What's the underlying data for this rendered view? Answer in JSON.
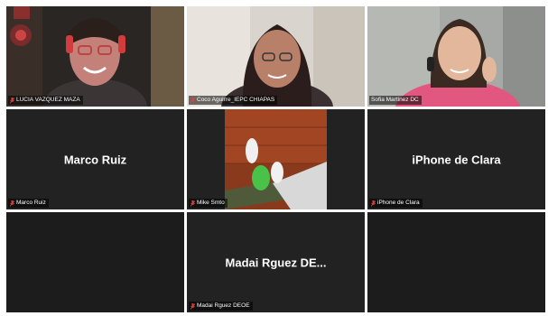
{
  "meeting": {
    "tiles": [
      {
        "label": "LUCIA VAZQUEZ MAZA",
        "center_name": "",
        "mic": "muted-mic-icon"
      },
      {
        "label": "Coco Aguirre_IEPC CHIAPAS",
        "center_name": "",
        "mic": "muted-mic-icon"
      },
      {
        "label": "Sofia Martinez DC",
        "center_name": "",
        "mic": ""
      },
      {
        "label": "Marco Ruiz",
        "center_name": "Marco Ruiz",
        "mic": "muted-mic-icon"
      },
      {
        "label": "Mike Smto",
        "center_name": "",
        "mic": "muted-mic-icon"
      },
      {
        "label": "iPhone de Clara",
        "center_name": "iPhone de Clara",
        "mic": "muted-mic-icon"
      },
      {
        "label": "Madai Rguez DEOE",
        "center_name": "Madai Rguez DE...",
        "mic": "muted-mic-icon"
      }
    ],
    "colors": {
      "tile_bg": "#222222",
      "active_speaker_border": "#b9e24a",
      "muted_icon": "#e0413a"
    }
  }
}
